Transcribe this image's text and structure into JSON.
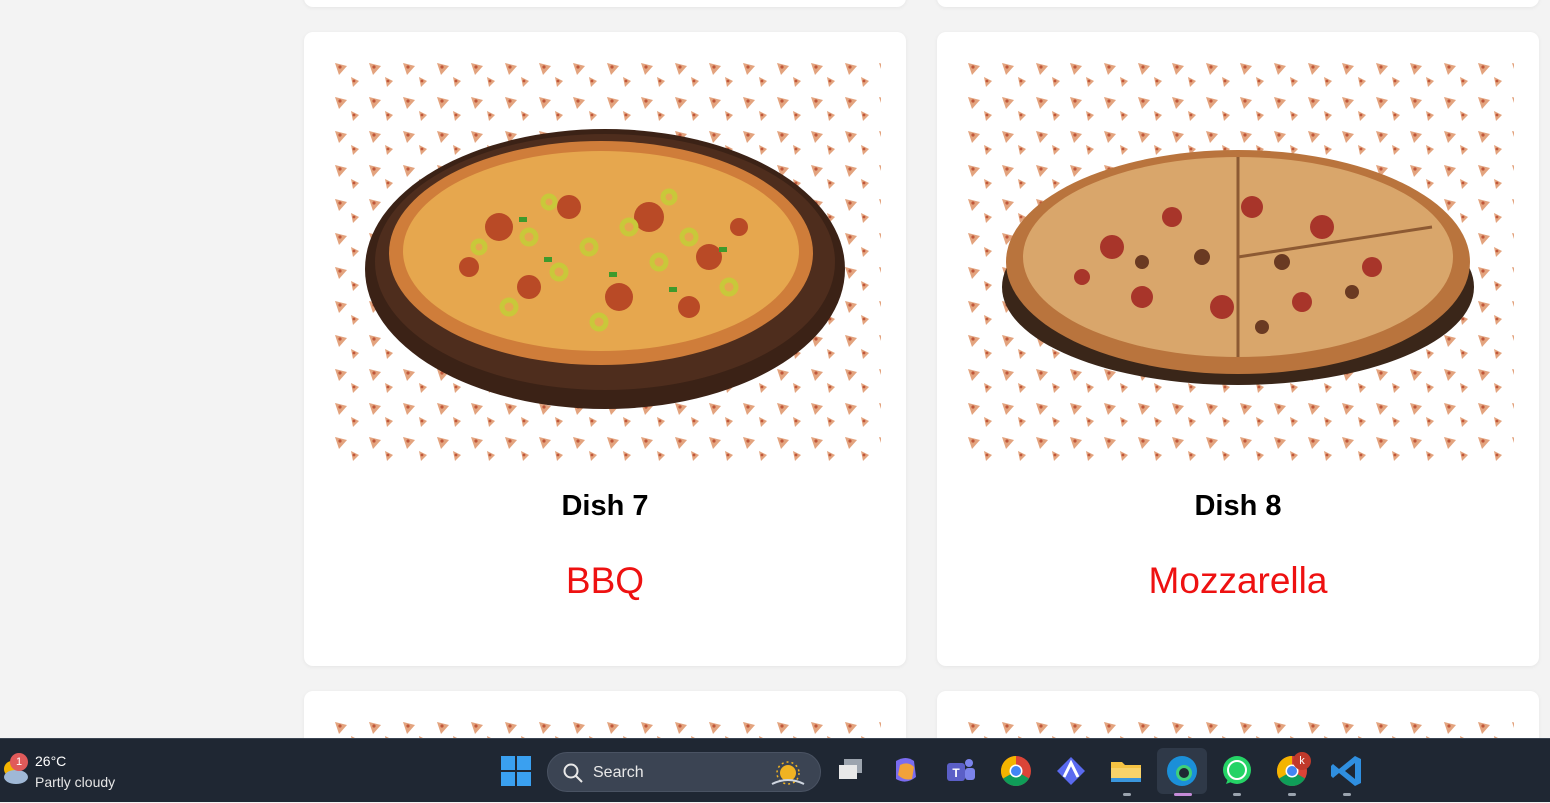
{
  "cards": [
    {
      "title": "Dish 7",
      "subtitle": "BBQ",
      "image": "pizza-bbq-image"
    },
    {
      "title": "Dish 8",
      "subtitle": "Mozzarella",
      "image": "pizza-mozzarella-image"
    }
  ],
  "taskbar": {
    "weather": {
      "temperature": "26°C",
      "condition": "Partly cloudy",
      "badge": "1"
    },
    "search": {
      "label": "Search"
    },
    "chrome_profile_badge": "k",
    "apps": [
      "start-icon",
      "search-icon",
      "task-view-icon",
      "copilot-icon",
      "teams-icon",
      "chrome-icon",
      "app-icon",
      "file-explorer-icon",
      "edge-icon",
      "whatsapp-icon",
      "chrome-profile-icon",
      "vscode-icon"
    ]
  },
  "colors": {
    "subtitle": "#ee1111",
    "taskbar": "#1f2733",
    "page_bg": "#f3f3f3"
  }
}
